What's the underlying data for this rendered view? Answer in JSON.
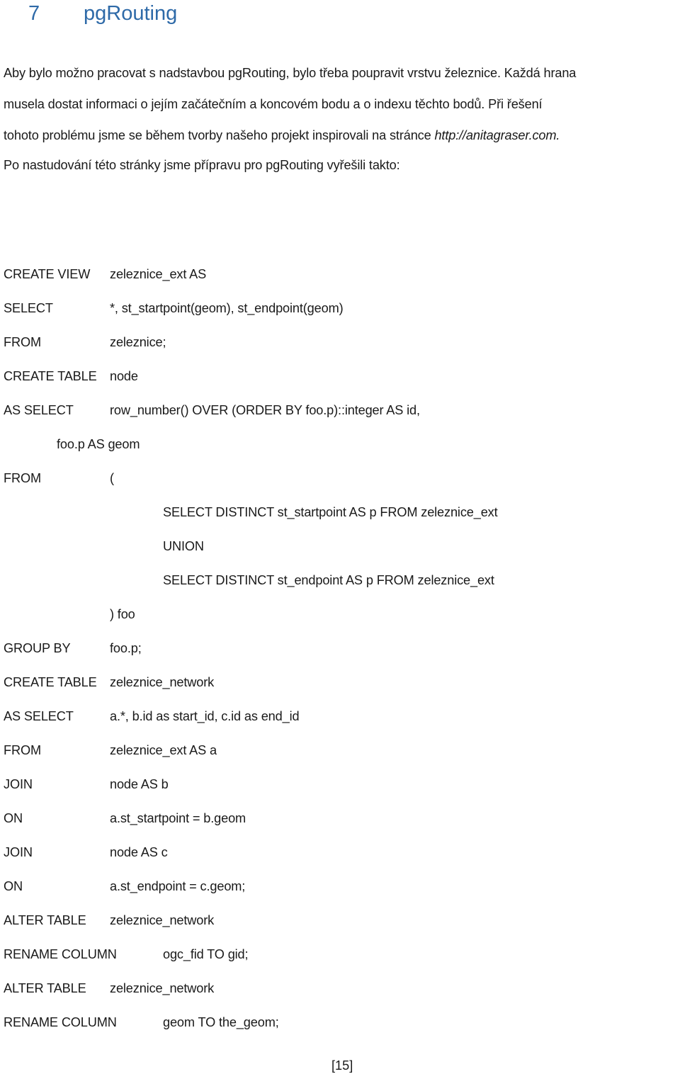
{
  "heading": {
    "number": "7",
    "title": "pgRouting"
  },
  "paragraph": {
    "lines": [
      "Aby bylo možno pracovat s nadstavbou pgRouting, bylo třeba poupravit vrstvu železnice. Každá hrana",
      "musela dostat informaci o jejím začátečním a koncovém bodu a o indexu těchto bodů. Při řešení"
    ],
    "line3_prefix": "tohoto problému jsme se během tvorby našeho projekt inspirovali na stránce ",
    "link": "http://anitagraser.com.",
    "line4": "Po nastudování této stránky jsme přípravu pro pgRouting vyřešili takto:"
  },
  "code": [
    {
      "kw": "CREATE VIEW",
      "arg": "zeleznice_ext AS"
    },
    {
      "kw": "SELECT",
      "arg": "*, st_startpoint(geom), st_endpoint(geom)"
    },
    {
      "kw": "FROM",
      "arg": "zeleznice;"
    },
    {
      "kw": "CREATE TABLE",
      "arg": "node"
    },
    {
      "kw": "AS SELECT",
      "arg": "row_number() OVER (ORDER BY foo.p)::integer AS id,"
    },
    {
      "kw": "",
      "arg": "foo.p AS geom"
    },
    {
      "kw": "FROM",
      "arg": "("
    },
    {
      "kw": "",
      "arg": "SELECT DISTINCT st_startpoint AS p FROM zeleznice_ext"
    },
    {
      "kw": "",
      "arg": "UNION"
    },
    {
      "kw": "",
      "arg": "SELECT DISTINCT st_endpoint AS p FROM zeleznice_ext"
    },
    {
      "kw": "",
      "arg": ") foo"
    },
    {
      "kw": "GROUP BY",
      "arg": "foo.p;"
    },
    {
      "kw": "CREATE TABLE",
      "arg": "zeleznice_network"
    },
    {
      "kw": "AS SELECT",
      "arg": "a.*, b.id as start_id, c.id as end_id"
    },
    {
      "kw": "FROM",
      "arg": "zeleznice_ext AS a"
    },
    {
      "kw": "JOIN",
      "arg": "node AS b"
    },
    {
      "kw": "ON",
      "arg": "a.st_startpoint = b.geom"
    },
    {
      "kw": "JOIN",
      "arg": "node AS c"
    },
    {
      "kw": "ON",
      "arg": "a.st_endpoint = c.geom;"
    },
    {
      "kw": "ALTER TABLE",
      "arg": "zeleznice_network"
    },
    {
      "kw": "RENAME COLUMN",
      "arg": "ogc_fid TO gid;"
    },
    {
      "kw": "ALTER TABLE",
      "arg": "zeleznice_network"
    },
    {
      "kw": "RENAME COLUMN",
      "arg": "geom TO the_geom;"
    }
  ],
  "page_number": "[15]"
}
